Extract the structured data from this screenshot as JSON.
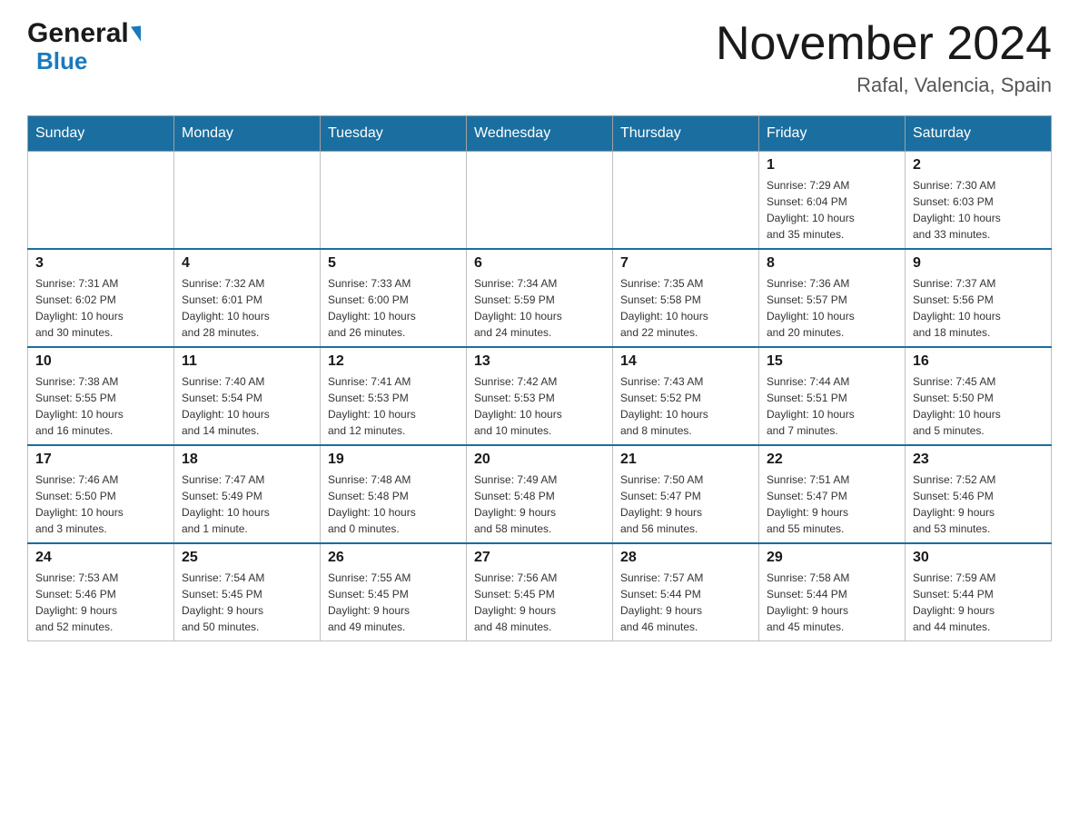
{
  "logo": {
    "general": "General",
    "blue": "Blue",
    "triangle": "▶"
  },
  "title": "November 2024",
  "location": "Rafal, Valencia, Spain",
  "days_of_week": [
    "Sunday",
    "Monday",
    "Tuesday",
    "Wednesday",
    "Thursday",
    "Friday",
    "Saturday"
  ],
  "weeks": [
    [
      {
        "day": "",
        "info": ""
      },
      {
        "day": "",
        "info": ""
      },
      {
        "day": "",
        "info": ""
      },
      {
        "day": "",
        "info": ""
      },
      {
        "day": "",
        "info": ""
      },
      {
        "day": "1",
        "info": "Sunrise: 7:29 AM\nSunset: 6:04 PM\nDaylight: 10 hours\nand 35 minutes."
      },
      {
        "day": "2",
        "info": "Sunrise: 7:30 AM\nSunset: 6:03 PM\nDaylight: 10 hours\nand 33 minutes."
      }
    ],
    [
      {
        "day": "3",
        "info": "Sunrise: 7:31 AM\nSunset: 6:02 PM\nDaylight: 10 hours\nand 30 minutes."
      },
      {
        "day": "4",
        "info": "Sunrise: 7:32 AM\nSunset: 6:01 PM\nDaylight: 10 hours\nand 28 minutes."
      },
      {
        "day": "5",
        "info": "Sunrise: 7:33 AM\nSunset: 6:00 PM\nDaylight: 10 hours\nand 26 minutes."
      },
      {
        "day": "6",
        "info": "Sunrise: 7:34 AM\nSunset: 5:59 PM\nDaylight: 10 hours\nand 24 minutes."
      },
      {
        "day": "7",
        "info": "Sunrise: 7:35 AM\nSunset: 5:58 PM\nDaylight: 10 hours\nand 22 minutes."
      },
      {
        "day": "8",
        "info": "Sunrise: 7:36 AM\nSunset: 5:57 PM\nDaylight: 10 hours\nand 20 minutes."
      },
      {
        "day": "9",
        "info": "Sunrise: 7:37 AM\nSunset: 5:56 PM\nDaylight: 10 hours\nand 18 minutes."
      }
    ],
    [
      {
        "day": "10",
        "info": "Sunrise: 7:38 AM\nSunset: 5:55 PM\nDaylight: 10 hours\nand 16 minutes."
      },
      {
        "day": "11",
        "info": "Sunrise: 7:40 AM\nSunset: 5:54 PM\nDaylight: 10 hours\nand 14 minutes."
      },
      {
        "day": "12",
        "info": "Sunrise: 7:41 AM\nSunset: 5:53 PM\nDaylight: 10 hours\nand 12 minutes."
      },
      {
        "day": "13",
        "info": "Sunrise: 7:42 AM\nSunset: 5:53 PM\nDaylight: 10 hours\nand 10 minutes."
      },
      {
        "day": "14",
        "info": "Sunrise: 7:43 AM\nSunset: 5:52 PM\nDaylight: 10 hours\nand 8 minutes."
      },
      {
        "day": "15",
        "info": "Sunrise: 7:44 AM\nSunset: 5:51 PM\nDaylight: 10 hours\nand 7 minutes."
      },
      {
        "day": "16",
        "info": "Sunrise: 7:45 AM\nSunset: 5:50 PM\nDaylight: 10 hours\nand 5 minutes."
      }
    ],
    [
      {
        "day": "17",
        "info": "Sunrise: 7:46 AM\nSunset: 5:50 PM\nDaylight: 10 hours\nand 3 minutes."
      },
      {
        "day": "18",
        "info": "Sunrise: 7:47 AM\nSunset: 5:49 PM\nDaylight: 10 hours\nand 1 minute."
      },
      {
        "day": "19",
        "info": "Sunrise: 7:48 AM\nSunset: 5:48 PM\nDaylight: 10 hours\nand 0 minutes."
      },
      {
        "day": "20",
        "info": "Sunrise: 7:49 AM\nSunset: 5:48 PM\nDaylight: 9 hours\nand 58 minutes."
      },
      {
        "day": "21",
        "info": "Sunrise: 7:50 AM\nSunset: 5:47 PM\nDaylight: 9 hours\nand 56 minutes."
      },
      {
        "day": "22",
        "info": "Sunrise: 7:51 AM\nSunset: 5:47 PM\nDaylight: 9 hours\nand 55 minutes."
      },
      {
        "day": "23",
        "info": "Sunrise: 7:52 AM\nSunset: 5:46 PM\nDaylight: 9 hours\nand 53 minutes."
      }
    ],
    [
      {
        "day": "24",
        "info": "Sunrise: 7:53 AM\nSunset: 5:46 PM\nDaylight: 9 hours\nand 52 minutes."
      },
      {
        "day": "25",
        "info": "Sunrise: 7:54 AM\nSunset: 5:45 PM\nDaylight: 9 hours\nand 50 minutes."
      },
      {
        "day": "26",
        "info": "Sunrise: 7:55 AM\nSunset: 5:45 PM\nDaylight: 9 hours\nand 49 minutes."
      },
      {
        "day": "27",
        "info": "Sunrise: 7:56 AM\nSunset: 5:45 PM\nDaylight: 9 hours\nand 48 minutes."
      },
      {
        "day": "28",
        "info": "Sunrise: 7:57 AM\nSunset: 5:44 PM\nDaylight: 9 hours\nand 46 minutes."
      },
      {
        "day": "29",
        "info": "Sunrise: 7:58 AM\nSunset: 5:44 PM\nDaylight: 9 hours\nand 45 minutes."
      },
      {
        "day": "30",
        "info": "Sunrise: 7:59 AM\nSunset: 5:44 PM\nDaylight: 9 hours\nand 44 minutes."
      }
    ]
  ]
}
